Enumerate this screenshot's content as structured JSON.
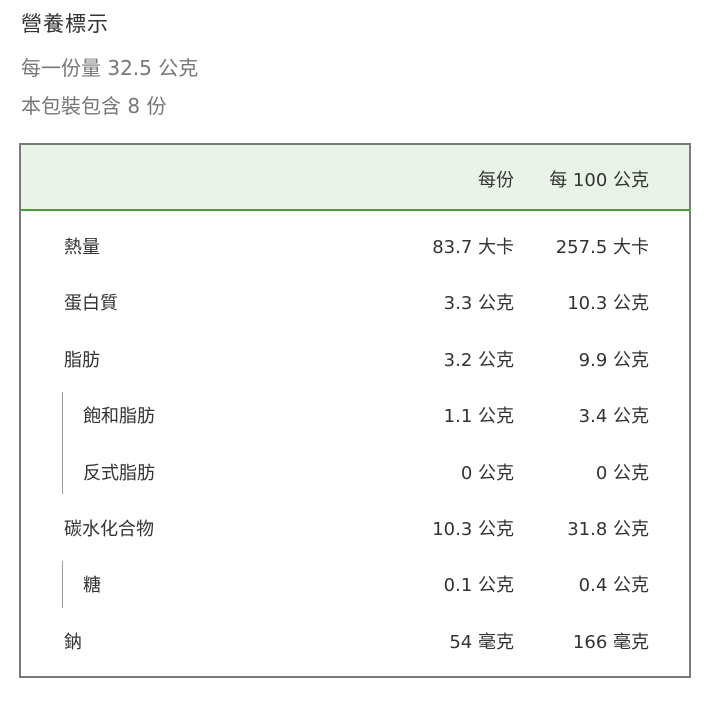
{
  "title": "營養標示",
  "serving_size": "每一份量 32.5 公克",
  "servings_per_pack": "本包裝包含 8 份",
  "header": {
    "per_serving": "每份",
    "per_100g": "每 100 公克"
  },
  "rows": [
    {
      "label": "熱量",
      "per_serving": "83.7 大卡",
      "per_100g": "257.5 大卡"
    },
    {
      "label": "蛋白質",
      "per_serving": "3.3 公克",
      "per_100g": "10.3 公克"
    },
    {
      "label": "脂肪",
      "per_serving": "3.2 公克",
      "per_100g": "9.9 公克"
    },
    {
      "label": "飽和脂肪",
      "per_serving": "1.1 公克",
      "per_100g": "3.4 公克"
    },
    {
      "label": "反式脂肪",
      "per_serving": "0 公克",
      "per_100g": "0 公克"
    },
    {
      "label": "碳水化合物",
      "per_serving": "10.3 公克",
      "per_100g": "31.8 公克"
    },
    {
      "label": "糖",
      "per_serving": "0.1 公克",
      "per_100g": "0.4 公克"
    },
    {
      "label": "鈉",
      "per_serving": "54 毫克",
      "per_100g": "166 毫克"
    }
  ]
}
